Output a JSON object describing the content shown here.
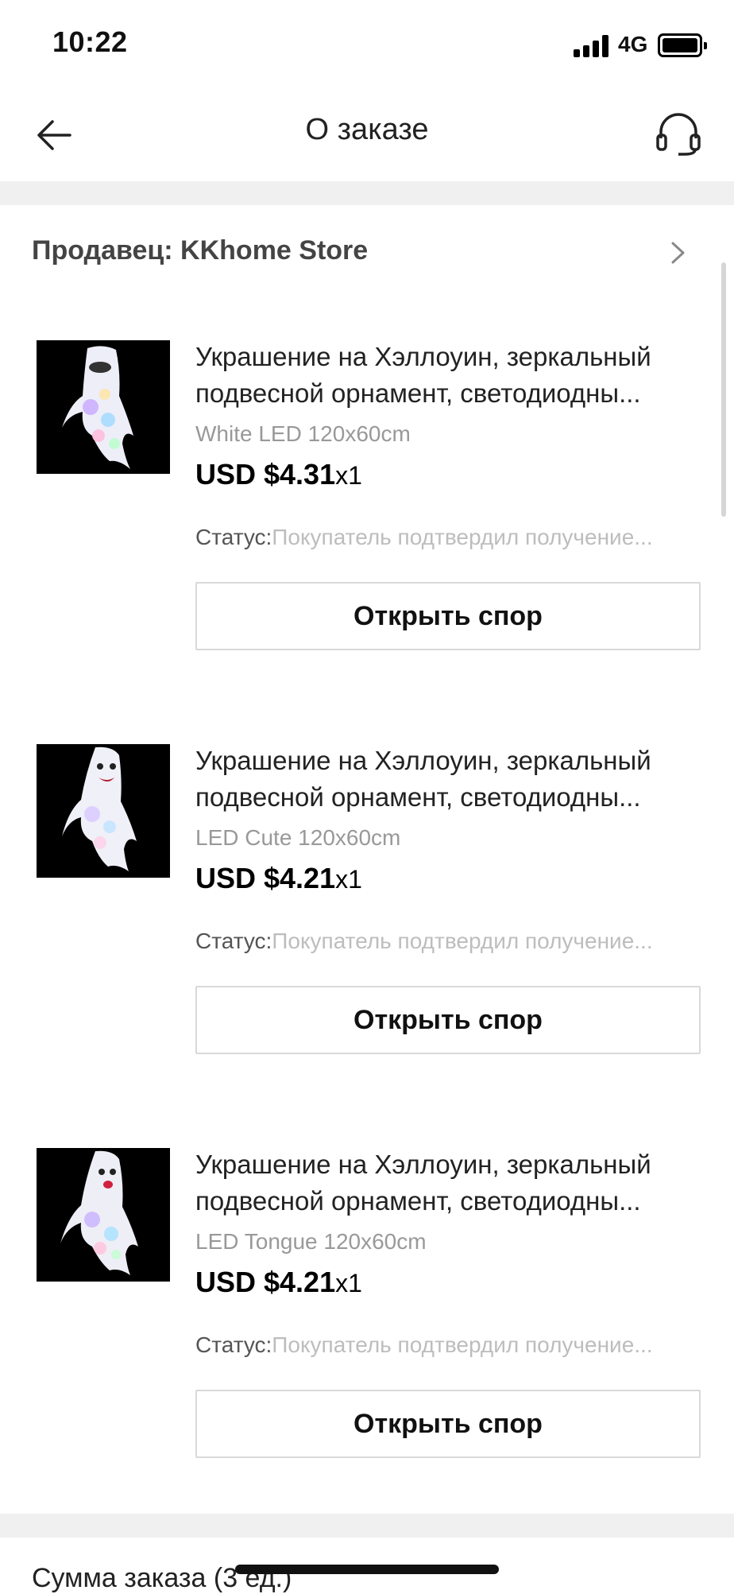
{
  "status_bar": {
    "time": "10:22",
    "network": "4G"
  },
  "header": {
    "title": "О заказе",
    "back_icon": "arrow-left-icon",
    "support_icon": "headset-icon"
  },
  "seller": {
    "label": "Продавец: KKhome Store"
  },
  "items": [
    {
      "title": "Украшение на Хэллоуин, зеркальный подвесной орнамент, светодиодны...",
      "variant": "White LED 120x60cm",
      "price": "USD $4.31",
      "qty": "x1",
      "status_label": "Статус:",
      "status_value": "Покупатель подтвердил получение...",
      "button": "Открыть спор"
    },
    {
      "title": "Украшение на Хэллоуин, зеркальный подвесной орнамент, светодиодны...",
      "variant": "LED Cute 120x60cm",
      "price": "USD $4.21",
      "qty": "x1",
      "status_label": "Статус:",
      "status_value": "Покупатель подтвердил получение...",
      "button": "Открыть спор"
    },
    {
      "title": "Украшение на Хэллоуин, зеркальный подвесной орнамент, светодиодны...",
      "variant": "LED Tongue 120x60cm",
      "price": "USD $4.21",
      "qty": "x1",
      "status_label": "Статус:",
      "status_value": "Покупатель подтвердил получение...",
      "button": "Открыть спор"
    }
  ],
  "summary": {
    "label": "Сумма заказа (3 ед.)"
  }
}
